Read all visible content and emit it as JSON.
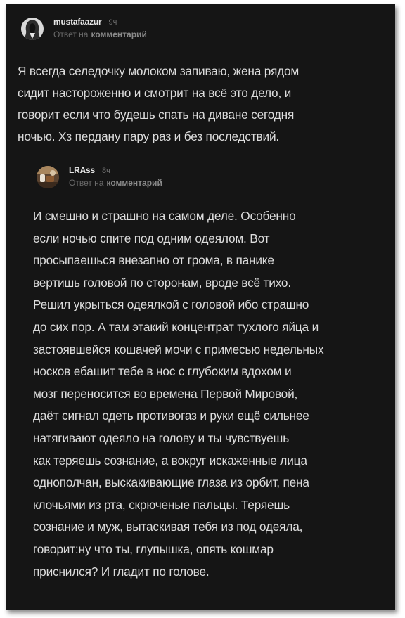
{
  "comments": [
    {
      "username": "mustafaazur",
      "time": "9ч",
      "reply_prefix": "Ответ на",
      "reply_target": "комментарий",
      "lines": [
        "Я всегда селедочку молоком запиваю, жена рядом",
        "сидит настороженно и смотрит на всё это дело, и",
        "говорит если что будешь спать на диване сегодня",
        "ночью. Хз пердану пару раз и без последствий."
      ]
    },
    {
      "username": "LRAss",
      "time": "8ч",
      "reply_prefix": "Ответ на",
      "reply_target": "комментарий",
      "lines": [
        "И смешно и страшно на самом деле. Особенно",
        "если ночью спите под одним одеялом. Вот",
        "просыпаешься внезапно от грома, в панике",
        "вертишь головой по сторонам, вроде всё тихо.",
        "Решил укрыться одеялкой с головой ибо страшно",
        "до сих пор. А там этакий концентрат тухлого яйца и",
        "застоявшейся кошачей мочи с примесью недельных",
        "носков ебашит тебе в нос с глубоким вдохом и",
        "мозг переносится во времена Первой Мировой,",
        "даёт сигнал одеть противогаз и руки ещё сильнее",
        "натягивают одеяло на голову и ты чувствуешь",
        "как теряешь сознание, а вокруг искаженные лица",
        "однополчан, выскакивающие глаза из орбит, пена",
        "клочьями из рта, скрюченые пальцы. Теряешь",
        "сознание и муж, вытаскивая тебя из под одеяла,",
        "говорит:ну что ты, глупышка, опять кошмар",
        "приснился? И гладит по голове."
      ]
    }
  ],
  "colors": {
    "background": "#151515",
    "text": "#dcdcdc",
    "username": "#e6e6e6",
    "muted": "#6a6a6a"
  }
}
